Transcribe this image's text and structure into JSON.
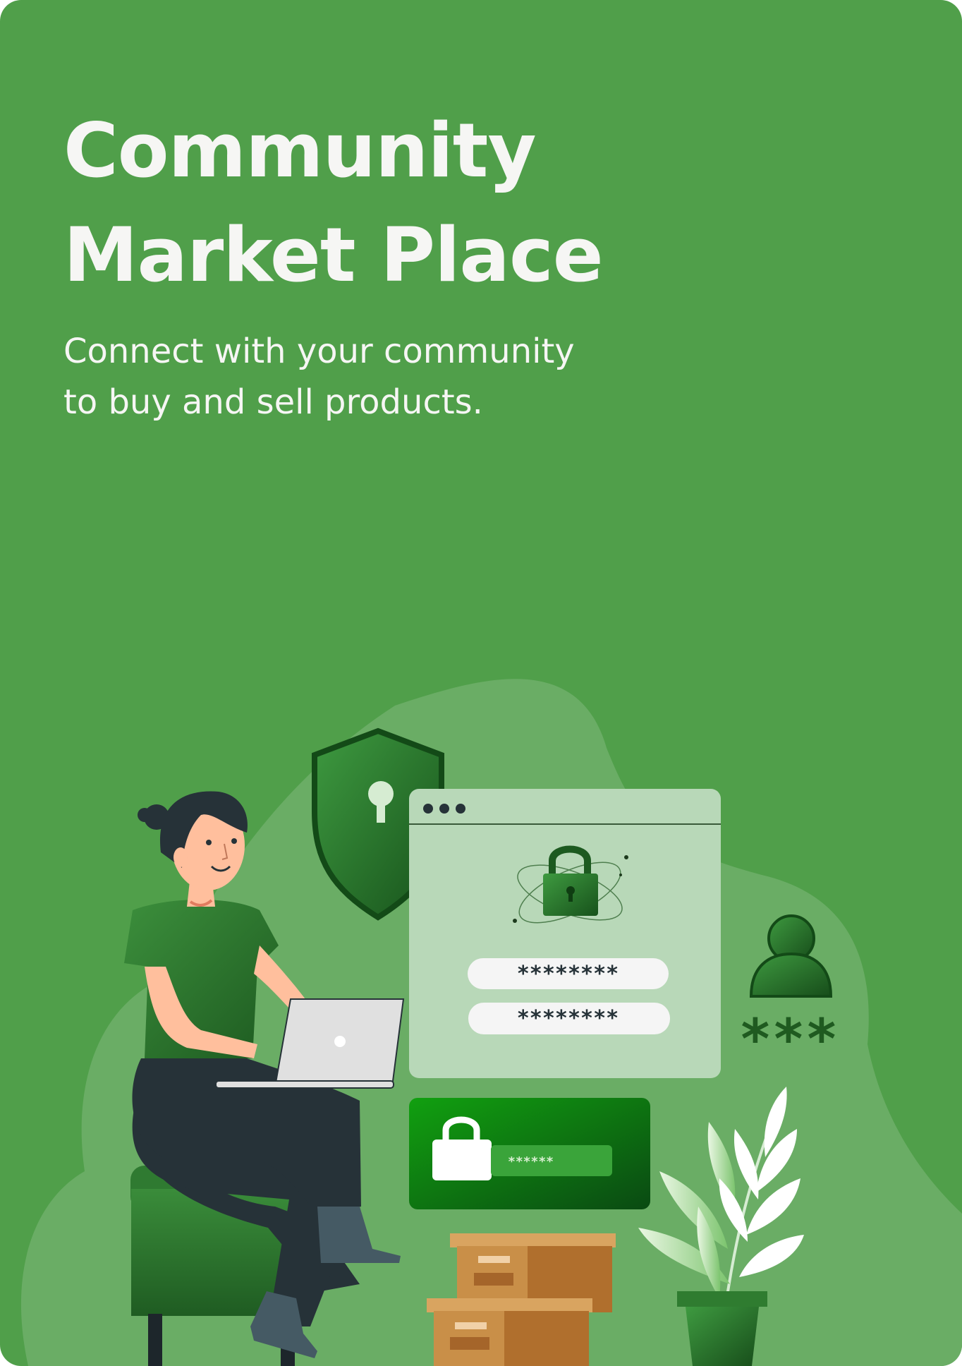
{
  "hero": {
    "title_line1": "Community",
    "title_line2": "Market Place",
    "subtitle_line1": "Connect with your community",
    "subtitle_line2": "to buy and sell products."
  },
  "illustration": {
    "password_field_1": "********",
    "password_field_2": "********",
    "lock_card_field": "******",
    "user_pin": "***"
  },
  "icons": {
    "shield": "shield-keyhole-icon",
    "padlock": "padlock-icon",
    "user": "user-icon",
    "laptop": "laptop-icon",
    "plant": "plant-icon",
    "boxes": "boxes-icon"
  },
  "colors": {
    "background": "#509f4a",
    "blob": "#6aad65",
    "text": "#f6f6f4",
    "window": "#b8d8b8",
    "dark_green": "#1f5a20",
    "box": "#c98f48"
  }
}
